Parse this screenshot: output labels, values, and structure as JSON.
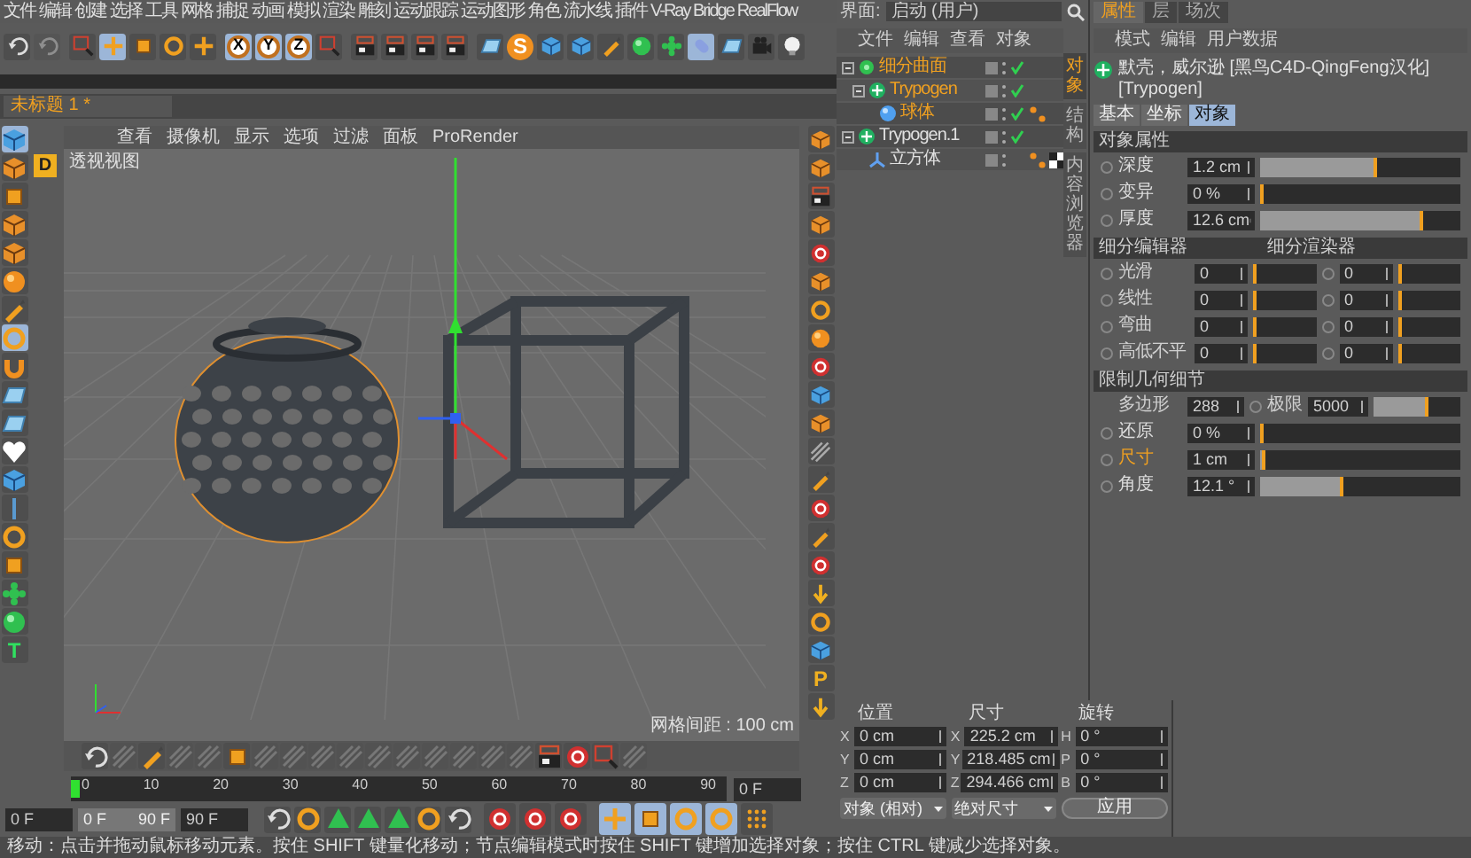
{
  "menu_bar": [
    "文件",
    "编辑",
    "创建",
    "选择",
    "工具",
    "网格",
    "捕捉",
    "动画",
    "模拟",
    "渲染",
    "雕刻",
    "运动跟踪",
    "运动图形",
    "角色",
    "流水线",
    "插件",
    "V-Ray Bridge",
    "RealFlow"
  ],
  "main_toolbar": {
    "axis_buttons": [
      {
        "label": "X",
        "selected": true
      },
      {
        "label": "Y",
        "selected": true
      },
      {
        "label": "Z",
        "selected": true
      }
    ],
    "letter_icon": "S"
  },
  "document_tab": {
    "label": "未标题 1 *",
    "selected": true
  },
  "viewport": {
    "menu": [
      "查看",
      "摄像机",
      "显示",
      "选项",
      "过滤",
      "面板",
      "ProRender"
    ],
    "corner_badge": "D",
    "title": "透视视图",
    "grid_spacing": "网格间距 : 100 cm"
  },
  "left_toolbar": {
    "letter_icon": "T"
  },
  "right_toolbar": {
    "letter_icon": "P"
  },
  "layout_selector": {
    "label": "界面:",
    "value": "启动 (用户)"
  },
  "object_manager": {
    "menu": [
      "文件",
      "编辑",
      "查看",
      "对象"
    ],
    "objects": [
      {
        "name": "细分曲面",
        "kind": "subdivision",
        "selected": true,
        "enabled": true,
        "expanded": true,
        "children": [
          {
            "name": "Trypogen",
            "kind": "generator",
            "selected": true,
            "enabled": true,
            "expanded": true,
            "children": [
              {
                "name": "球体",
                "kind": "sphere",
                "selected": true,
                "enabled": true,
                "tags": [
                  {
                    "kind": "phong"
                  }
                ]
              }
            ]
          }
        ]
      },
      {
        "name": "Trypogen.1",
        "kind": "generator",
        "selected": false,
        "enabled": true,
        "expanded": true,
        "children": [
          {
            "name": "立方体",
            "kind": "cube",
            "selected": false,
            "enabled": false,
            "tags": [
              {
                "kind": "phong"
              },
              {
                "kind": "checker"
              }
            ]
          }
        ]
      }
    ],
    "side_tabs": [
      {
        "label": "对象",
        "selected": true
      },
      {
        "label": "结构",
        "selected": false
      },
      {
        "label": "内容浏览器",
        "selected": false
      }
    ]
  },
  "attribute_manager": {
    "tabs": [
      {
        "label": "属性",
        "selected": true
      },
      {
        "label": "层",
        "selected": false
      },
      {
        "label": "场次",
        "selected": false
      }
    ],
    "menu": [
      "模式",
      "编辑",
      "用户数据"
    ],
    "header": "默壳，威尔逊 [黑鸟C4D-QingFeng汉化] [Trypogen]",
    "sub_tabs": [
      {
        "label": "基本",
        "selected": false
      },
      {
        "label": "坐标",
        "selected": false
      },
      {
        "label": "对象",
        "selected": true
      }
    ],
    "sections": [
      {
        "title": "对象属性",
        "rows": [
          {
            "kind": "slider",
            "label": "深度",
            "value": "1.2 cm",
            "level": 0.57,
            "highlighted": false
          },
          {
            "kind": "slider",
            "label": "变异",
            "value": "0 %",
            "level": 0,
            "highlighted": false
          },
          {
            "kind": "slider",
            "label": "厚度",
            "value": "12.6 cm",
            "level": 0.8,
            "highlighted": false
          }
        ]
      },
      {
        "title": "细分编辑器",
        "title_2": "细分渲染器",
        "rows": [
          {
            "kind": "pair",
            "label": "光滑",
            "value": "0",
            "value_2": "0"
          },
          {
            "kind": "pair",
            "label": "线性",
            "value": "0",
            "value_2": "0"
          },
          {
            "kind": "pair",
            "label": "弯曲",
            "value": "0",
            "value_2": "0"
          },
          {
            "kind": "pair",
            "label": "高低不平",
            "value": "0",
            "value_2": "0"
          }
        ]
      },
      {
        "title": "限制几何细节",
        "rows": [
          {
            "kind": "limit",
            "label": "多边形",
            "value": "288",
            "label_2": "极限",
            "value_2": "5000",
            "level": 0.6
          },
          {
            "kind": "slider",
            "label": "还原",
            "value": "0 %",
            "level": 0,
            "highlighted": false
          },
          {
            "kind": "slider",
            "label": "尺寸",
            "value": "1 cm",
            "level": 0.01,
            "highlighted": true
          },
          {
            "kind": "slider",
            "label": "角度",
            "value": "12.1 °",
            "level": 0.4,
            "highlighted": false
          }
        ]
      }
    ]
  },
  "coordinates": {
    "headers": [
      "位置",
      "尺寸",
      "旋转"
    ],
    "rows": [
      [
        {
          "axis": "X",
          "value": "0 cm"
        },
        {
          "axis": "X",
          "value": "225.2 cm"
        },
        {
          "axis": "H",
          "value": "0 °"
        }
      ],
      [
        {
          "axis": "Y",
          "value": "0 cm"
        },
        {
          "axis": "Y",
          "value": "218.485 cm"
        },
        {
          "axis": "P",
          "value": "0 °"
        }
      ],
      [
        {
          "axis": "Z",
          "value": "0 cm"
        },
        {
          "axis": "Z",
          "value": "294.466 cm"
        },
        {
          "axis": "B",
          "value": "0 °"
        }
      ]
    ],
    "mode_dropdown": "对象 (相对)",
    "size_dropdown": "绝对尺寸",
    "apply_button": "应用"
  },
  "timeline": {
    "ticks": [
      "0",
      "10",
      "20",
      "30",
      "40",
      "50",
      "60",
      "70",
      "80",
      "90"
    ],
    "current_frame": "0 F"
  },
  "playback": {
    "start": "0 F",
    "range": {
      "start": "0 F",
      "end": "90 F",
      "level": 1
    },
    "end": "90 F"
  },
  "status_bar": "移动：点击并拖动鼠标移动元素。按住 SHIFT 键量化移动；节点编辑模式时按住 SHIFT 键增加选择对象；按住 CTRL 键减少选择对象。"
}
